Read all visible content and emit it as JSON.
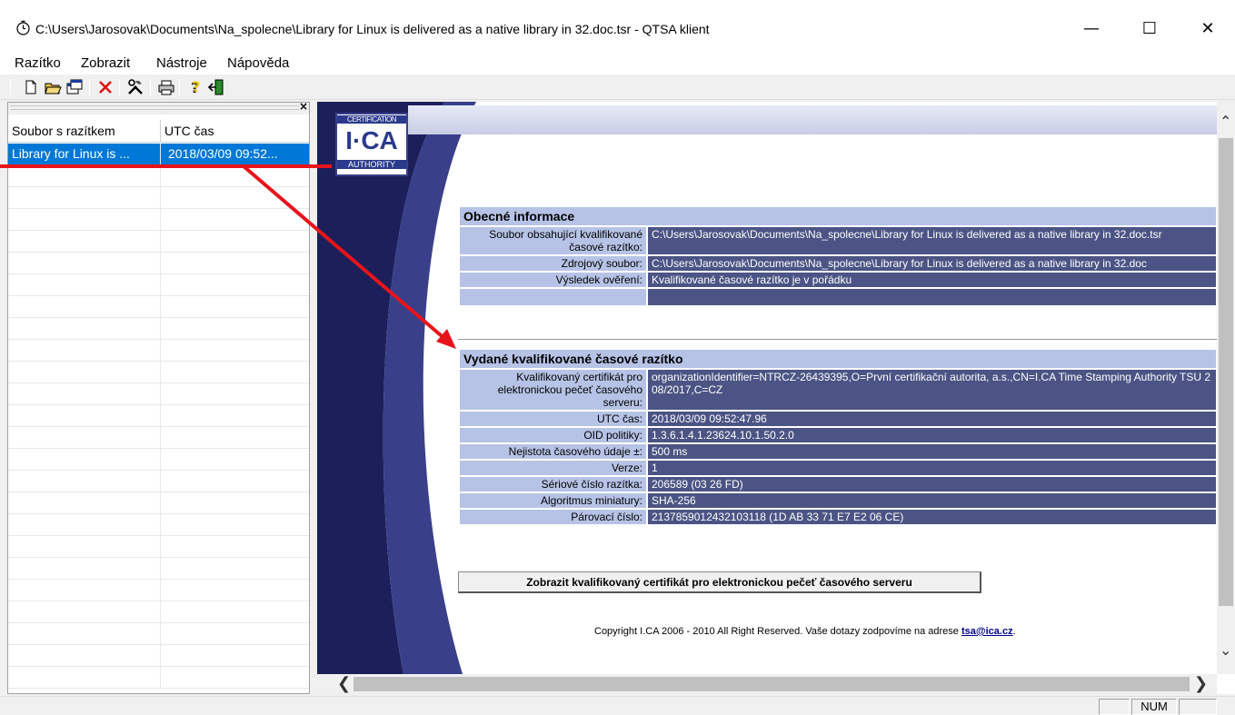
{
  "window": {
    "title": "C:\\Users\\Jarosovak\\Documents\\Na_spolecne\\Library for Linux is delivered as a native library in 32.doc.tsr - QTSA klient",
    "minimize": "—",
    "maximize": "☐",
    "close": "✕"
  },
  "menu": {
    "items": [
      "Razítko",
      "Zobrazit",
      "Nástroje",
      "Nápověda"
    ]
  },
  "toolbar": {
    "icons": [
      "new-icon",
      "open-icon",
      "windows-icon",
      "delete-icon",
      "tools-icon",
      "print-icon",
      "help-icon",
      "exit-icon"
    ]
  },
  "left_panel": {
    "columns": [
      "Soubor s razítkem",
      "UTC čas"
    ],
    "rows": [
      {
        "file": "Library for Linux is ...",
        "utc": "2018/03/09  09:52..."
      }
    ]
  },
  "logo": {
    "line1": "CERTIFICATION",
    "line2": "I·CA",
    "line3": "AUTHORITY"
  },
  "general": {
    "heading": "Obecné informace",
    "rows": [
      {
        "label": "Soubor obsahující kvalifikované časové razítko:",
        "value": "C:\\Users\\Jarosovak\\Documents\\Na_spolecne\\Library for Linux is delivered as a native library in 32.doc.tsr"
      },
      {
        "label": "Zdrojový soubor:",
        "value": "C:\\Users\\Jarosovak\\Documents\\Na_spolecne\\Library for Linux is delivered as a native library in 32.doc"
      },
      {
        "label": "Výsledek ověření:",
        "value": "Kvalifikované časové razítko je v pořádku"
      },
      {
        "label": "",
        "value": ""
      }
    ]
  },
  "timestamp": {
    "heading": "Vydané kvalifikované časové razítko",
    "rows": [
      {
        "label": "Kvalifikovaný certifikát pro elektronickou pečeť časového serveru:",
        "value": "organizationIdentifier=NTRCZ-26439395,O=První certifikační autorita, a.s.,CN=I.CA Time Stamping Authority TSU 2 08/2017,C=CZ"
      },
      {
        "label": "UTC čas:",
        "value": "2018/03/09  09:52:47.96"
      },
      {
        "label": "OID politiky:",
        "value": "1.3.6.1.4.1.23624.10.1.50.2.0"
      },
      {
        "label": "Nejistota časového údaje ±:",
        "value": "500 ms"
      },
      {
        "label": "Verze:",
        "value": "1"
      },
      {
        "label": "Sériové číslo razítka:",
        "value": "206589 (03 26 FD)"
      },
      {
        "label": "Algoritmus miniatury:",
        "value": "SHA-256"
      },
      {
        "label": "Párovací číslo:",
        "value": "2137859012432103118 (1D AB 33 71 E7 E2 06 CE)"
      }
    ]
  },
  "cert_button": "Zobrazit kvalifikovaný certifikát pro elektronickou pečeť  časového serveru",
  "copyright": {
    "text": "Copyright I.CA 2006 - 2010 All Right Reserved. Vaše dotazy zodpovíme na adrese ",
    "email": "tsa@ica.cz",
    "end": "."
  },
  "status": {
    "num": "NUM"
  },
  "colors": {
    "selection": "#0078d7",
    "label_bg": "#b6c3e6",
    "value_bg": "#4b5484",
    "swoosh": "#262a66",
    "arrow": "#e8141b"
  }
}
